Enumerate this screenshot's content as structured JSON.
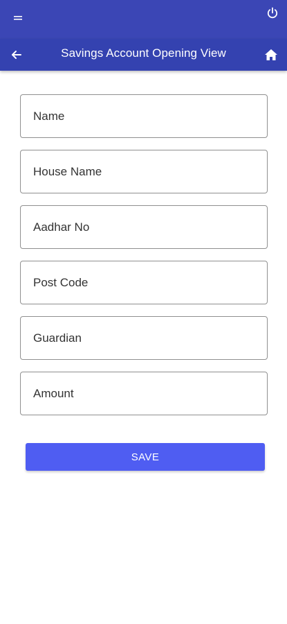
{
  "header": {
    "title": "Savings Account Opening View",
    "menu_icon": "menu-icon",
    "power_icon": "power-icon",
    "back_icon": "back-arrow-icon",
    "home_icon": "home-icon"
  },
  "colors": {
    "statusbar": "#3b46b5",
    "appbar": "#3442b0",
    "button": "#4f5df2"
  },
  "form": {
    "fields": [
      {
        "placeholder": "Name",
        "value": ""
      },
      {
        "placeholder": "House Name",
        "value": ""
      },
      {
        "placeholder": "Aadhar No",
        "value": ""
      },
      {
        "placeholder": "Post Code",
        "value": ""
      },
      {
        "placeholder": "Guardian",
        "value": ""
      },
      {
        "placeholder": "Amount",
        "value": ""
      }
    ],
    "save_label": "SAVE"
  }
}
